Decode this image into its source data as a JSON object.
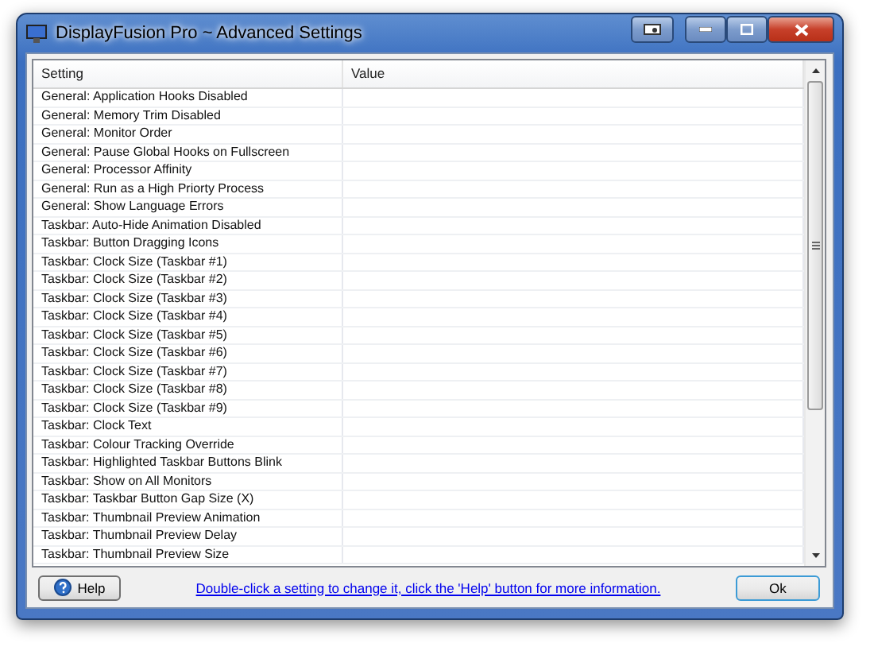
{
  "window": {
    "title": "DisplayFusion Pro ~ Advanced Settings"
  },
  "table": {
    "columns": [
      "Setting",
      "Value"
    ],
    "rows": [
      {
        "setting": "General: Application Hooks Disabled"
      },
      {
        "setting": "General: Memory Trim Disabled"
      },
      {
        "setting": "General: Monitor Order"
      },
      {
        "setting": "General: Pause Global Hooks on Fullscreen"
      },
      {
        "setting": "General: Processor Affinity"
      },
      {
        "setting": "General: Run as a High Priorty Process"
      },
      {
        "setting": "General: Show Language Errors"
      },
      {
        "setting": "Taskbar: Auto-Hide Animation Disabled"
      },
      {
        "setting": "Taskbar: Button Dragging Icons"
      },
      {
        "setting": "Taskbar: Clock Size (Taskbar #1)"
      },
      {
        "setting": "Taskbar: Clock Size (Taskbar #2)"
      },
      {
        "setting": "Taskbar: Clock Size (Taskbar #3)"
      },
      {
        "setting": "Taskbar: Clock Size (Taskbar #4)"
      },
      {
        "setting": "Taskbar: Clock Size (Taskbar #5)"
      },
      {
        "setting": "Taskbar: Clock Size (Taskbar #6)"
      },
      {
        "setting": "Taskbar: Clock Size (Taskbar #7)"
      },
      {
        "setting": "Taskbar: Clock Size (Taskbar #8)"
      },
      {
        "setting": "Taskbar: Clock Size (Taskbar #9)"
      },
      {
        "setting": "Taskbar: Clock Text"
      },
      {
        "setting": "Taskbar: Colour Tracking Override"
      },
      {
        "setting": "Taskbar: Highlighted Taskbar Buttons Blink"
      },
      {
        "setting": "Taskbar: Show on All Monitors"
      },
      {
        "setting": "Taskbar: Taskbar Button Gap Size (X)"
      },
      {
        "setting": "Taskbar: Thumbnail Preview Animation"
      },
      {
        "setting": "Taskbar: Thumbnail Preview Delay"
      },
      {
        "setting": "Taskbar: Thumbnail Preview Size"
      }
    ]
  },
  "footer": {
    "help_button": "Help",
    "hint_link": "Double-click a setting to change it, click the 'Help' button for more information.",
    "ok_button": "Ok"
  }
}
